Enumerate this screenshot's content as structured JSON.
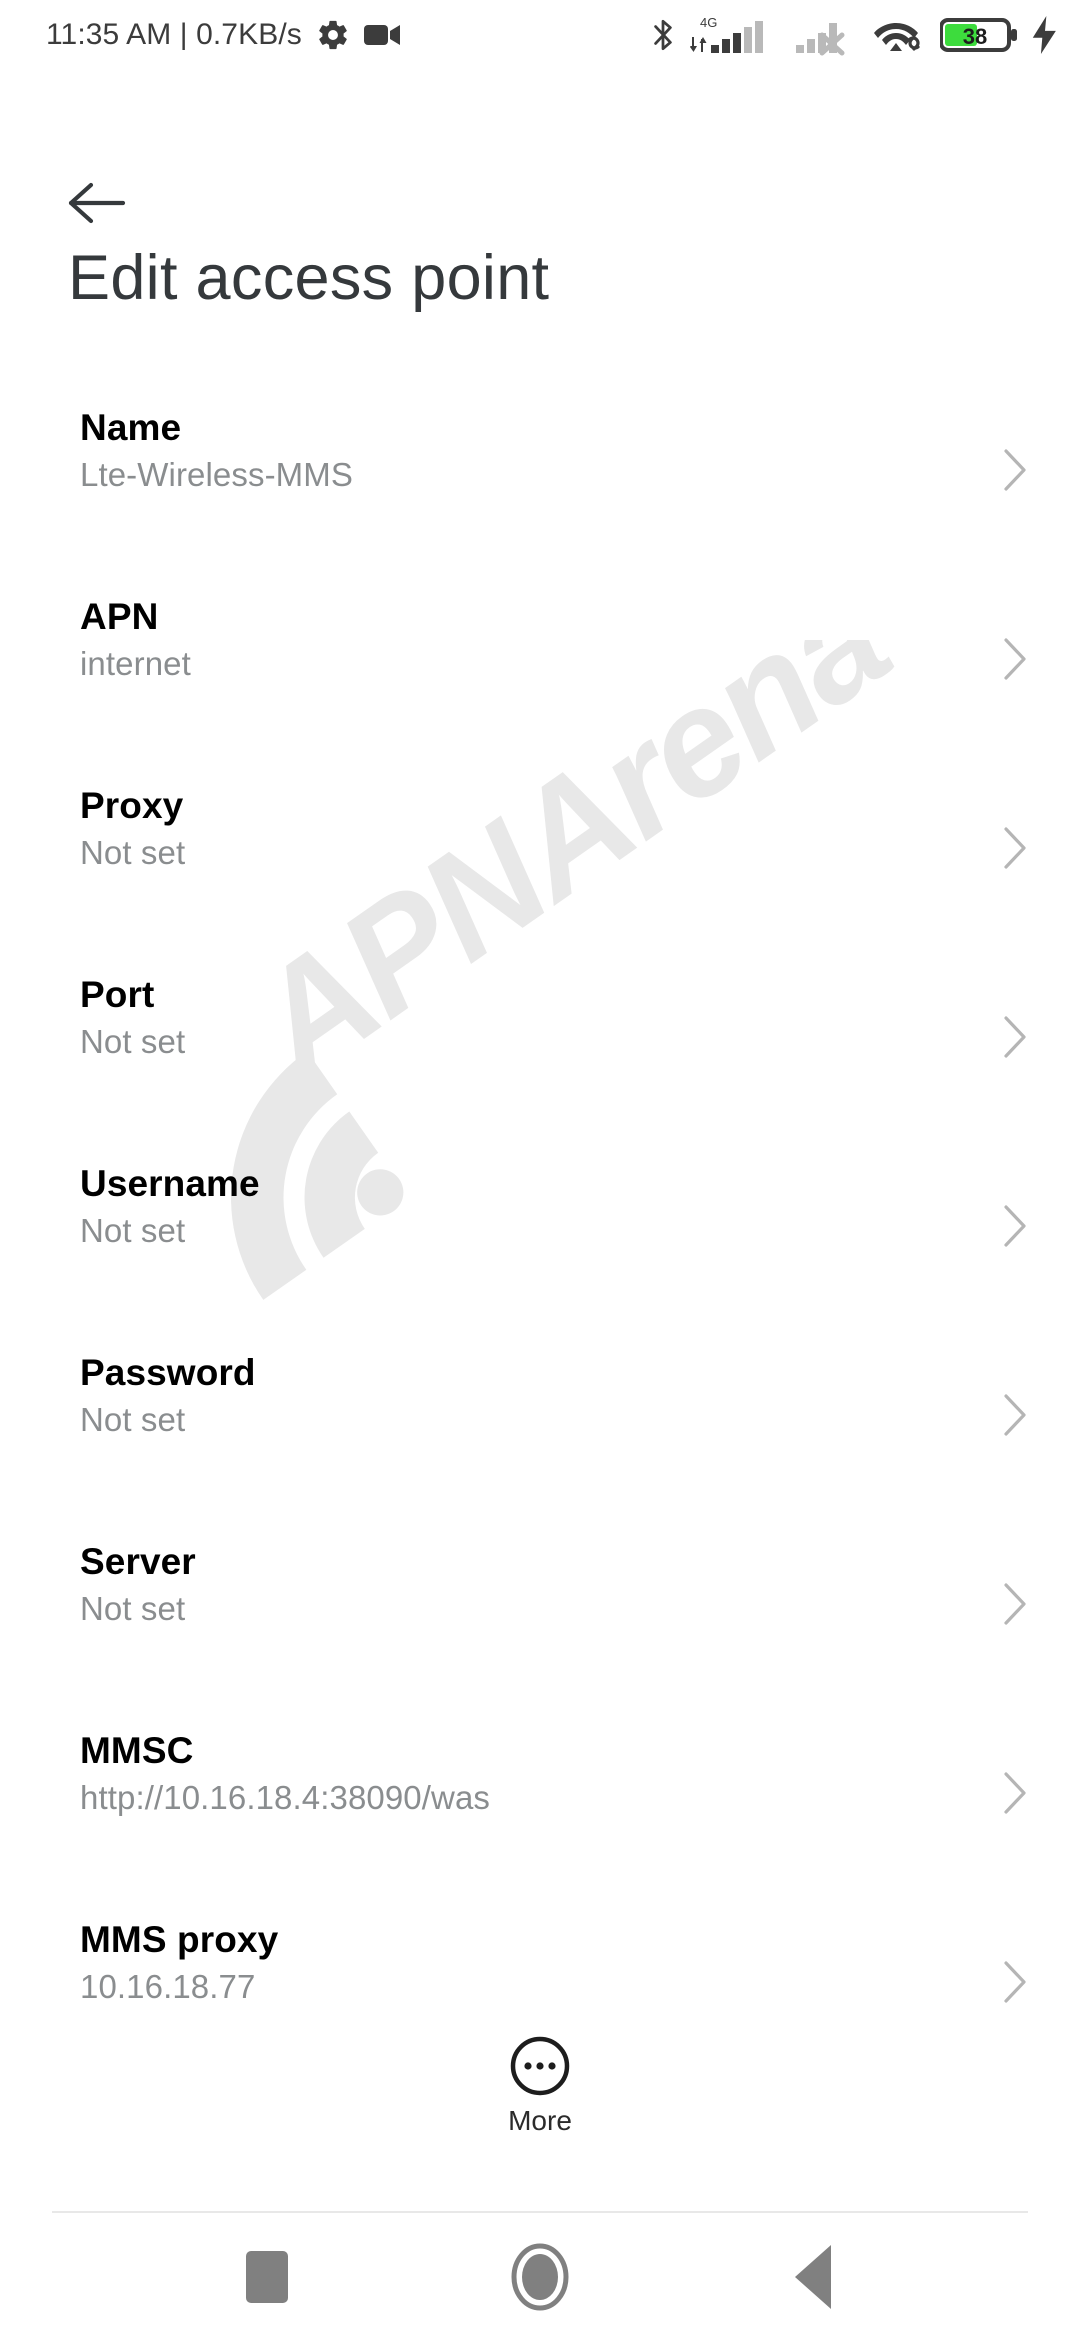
{
  "statusbar": {
    "time_and_speed": "11:35 AM | 0.7KB/s",
    "gear_icon": "gear-icon",
    "camcorder_icon": "camcorder-icon",
    "bluetooth_icon": "bluetooth-icon",
    "sim1_network_label": "4G",
    "sim1_signal_icon": "signal-bars-icon",
    "sim2_signal_icon": "signal-bars-no-service-icon",
    "wifi_icon": "wifi-icon",
    "battery_level": "38",
    "battery_charging_icon": "charging-bolt-icon",
    "colors": {
      "text": "#3c3c3c",
      "battery_green": "#3ddc3d"
    }
  },
  "appbar": {
    "back_icon": "back-arrow-icon",
    "title": "Edit access point"
  },
  "list": {
    "chevron_icon": "chevron-right-icon",
    "rows": [
      {
        "title": "Name",
        "value": "Lte-Wireless-MMS"
      },
      {
        "title": "APN",
        "value": "internet"
      },
      {
        "title": "Proxy",
        "value": "Not set"
      },
      {
        "title": "Port",
        "value": "Not set"
      },
      {
        "title": "Username",
        "value": "Not set"
      },
      {
        "title": "Password",
        "value": "Not set"
      },
      {
        "title": "Server",
        "value": "Not set"
      },
      {
        "title": "MMSC",
        "value": "http://10.16.18.4:38090/was"
      },
      {
        "title": "MMS proxy",
        "value": "10.16.18.77"
      }
    ]
  },
  "more_button": {
    "label": "More",
    "icon": "more-ellipsis-circle-icon"
  },
  "navbar": {
    "recents_icon": "recents-square-icon",
    "home_icon": "home-circle-icon",
    "back_icon": "back-triangle-icon"
  },
  "watermark": {
    "text": "APNArena",
    "icon": "wifi-signal-icon",
    "color": "#e8e8e8"
  }
}
